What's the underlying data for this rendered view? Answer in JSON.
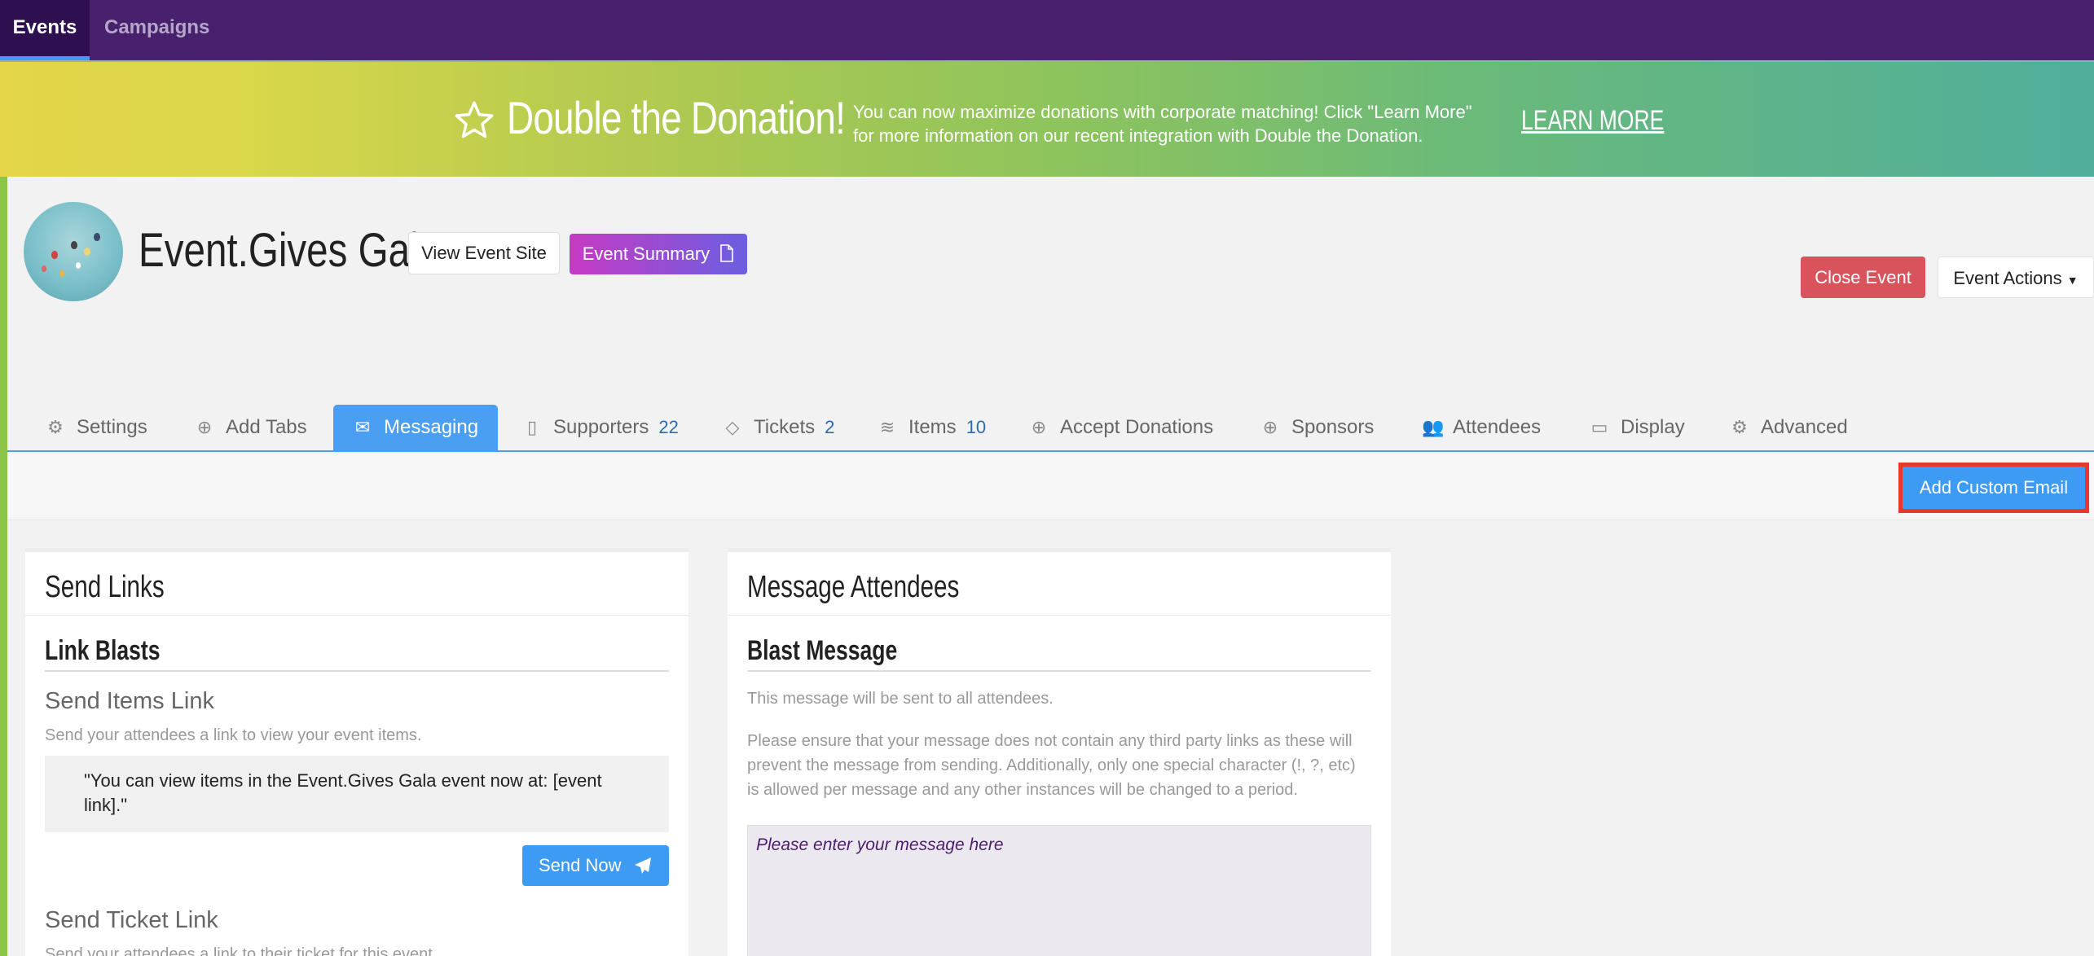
{
  "nav": {
    "tabs": [
      "Events",
      "Campaigns"
    ]
  },
  "banner": {
    "title": "Double the Donation!",
    "message": "You can now maximize donations with corporate matching! Click \"Learn More\" for more information on our recent integration with Double the Donation.",
    "cta": "LEARN MORE"
  },
  "event": {
    "title": "Event.Gives Gala",
    "view_site": "View Event Site",
    "summary": "Event Summary",
    "close": "Close Event",
    "actions": "Event Actions"
  },
  "tabs": [
    {
      "label": "Settings",
      "icon": "gear-icon"
    },
    {
      "label": "Add Tabs",
      "icon": "plus-circle-icon"
    },
    {
      "label": "Messaging",
      "icon": "inbox-icon",
      "active": true
    },
    {
      "label": "Supporters",
      "count": "22",
      "icon": "clipboard-icon"
    },
    {
      "label": "Tickets",
      "count": "2",
      "icon": "ticket-icon"
    },
    {
      "label": "Items",
      "count": "10",
      "icon": "layers-icon"
    },
    {
      "label": "Accept Donations",
      "icon": "plus-circle-icon"
    },
    {
      "label": "Sponsors",
      "icon": "plus-circle-icon"
    },
    {
      "label": "Attendees",
      "icon": "users-icon"
    },
    {
      "label": "Display",
      "icon": "monitor-icon"
    },
    {
      "label": "Advanced",
      "icon": "gears-icon"
    }
  ],
  "toolbar": {
    "add_custom_email": "Add Custom Email"
  },
  "send_links": {
    "heading": "Send Links",
    "section": "Link Blasts",
    "items": {
      "title": "Send Items Link",
      "hint": "Send your attendees a link to view your event items.",
      "message": "\"You can view items in the Event.Gives Gala event now at: [event link].\"",
      "button": "Send Now"
    },
    "ticket": {
      "title": "Send Ticket Link",
      "hint": "Send your attendees a link to their ticket for this event."
    }
  },
  "message_attendees": {
    "heading": "Message Attendees",
    "section": "Blast Message",
    "hint1": "This message will be sent to all attendees.",
    "hint2": "Please ensure that your message does not contain any third party links as these will prevent the message from sending. Additionally, only one special character (!, ?, etc) is allowed per message and any other instances will be changed to a period.",
    "placeholder": "Please enter your message here"
  }
}
